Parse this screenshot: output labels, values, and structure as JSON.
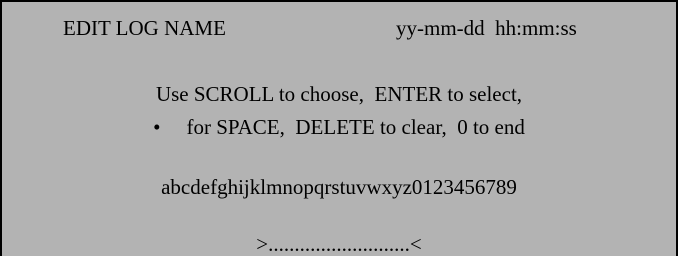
{
  "header": {
    "title": "EDIT LOG NAME",
    "datetime_format": "yy-mm-dd  hh:mm:ss"
  },
  "instructions": {
    "line1": "Use SCROLL to choose,  ENTER to select,",
    "bullet": "•",
    "line2": "for SPACE,  DELETE to clear,  0 to end"
  },
  "character_set": "abcdefghijklmnopqrstuvwxyz0123456789",
  "name_entry": ">...........................<",
  "colors": {
    "screen_background": "#b3b3b3",
    "border": "#000000",
    "text": "#000000"
  }
}
